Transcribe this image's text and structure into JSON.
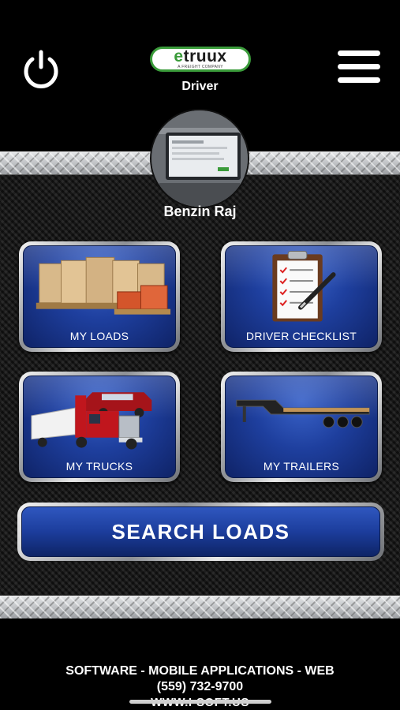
{
  "header": {
    "logo_text_e": "e",
    "logo_text_rest": "truux",
    "logo_subtitle": "A FREIGHT COMPANY",
    "role": "Driver",
    "power_icon": "power-icon",
    "menu_icon": "hamburger-menu-icon"
  },
  "profile": {
    "name": "Benzin Raj"
  },
  "tiles": [
    {
      "label": "MY LOADS",
      "icon": "pallet-boxes-icon"
    },
    {
      "label": "DRIVER CHECKLIST",
      "icon": "clipboard-checklist-icon"
    },
    {
      "label": "MY TRUCKS",
      "icon": "semi-truck-icon"
    },
    {
      "label": "MY TRAILERS",
      "icon": "flatbed-trailer-icon"
    }
  ],
  "search_button": {
    "label": "SEARCH LOADS"
  },
  "footer": {
    "line1": "SOFTWARE - MOBILE APPLICATIONS - WEB",
    "line2": "(559) 732-9700",
    "line3": "WWW.I-SOFT.US"
  },
  "colors": {
    "accent_green": "#3a9b3a",
    "tile_blue": "#1e3f9e",
    "background": "#000000"
  }
}
